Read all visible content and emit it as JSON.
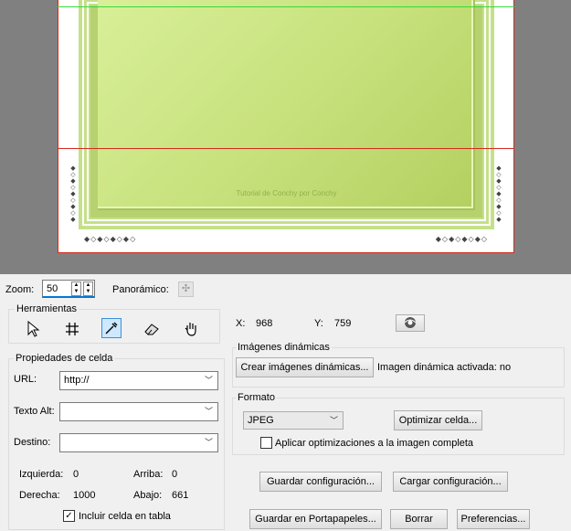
{
  "preview": {
    "watermark": "Tutorial de Conchy por Conchy"
  },
  "zoom": {
    "label": "Zoom:",
    "value": "50"
  },
  "pan": {
    "label": "Panorámico:"
  },
  "tools": {
    "title": "Herramientas",
    "items": [
      "arrow-select-icon",
      "grid-slice-icon",
      "eyedropper-icon",
      "eraser-icon",
      "hand-pan-icon"
    ]
  },
  "coords": {
    "x_label": "X:",
    "x_value": "968",
    "y_label": "Y:",
    "y_value": "759"
  },
  "cell_props": {
    "title": "Propiedades de celda",
    "url_label": "URL:",
    "url_value": "http://",
    "alt_label": "Texto Alt:",
    "alt_value": "",
    "target_label": "Destino:",
    "target_value": "",
    "left_label": "Izquierda:",
    "left_value": "0",
    "top_label": "Arriba:",
    "top_value": "0",
    "right_label": "Derecha:",
    "right_value": "1000",
    "bottom_label": "Abajo:",
    "bottom_value": "661",
    "include_label": "Incluir celda en tabla",
    "include_checked": true
  },
  "dynamic": {
    "title": "Imágenes dinámicas",
    "create_button": "Crear imágenes dinámicas...",
    "status": "Imagen dinámica activada: no"
  },
  "format": {
    "title": "Formato",
    "selected": "JPEG",
    "optimize_button": "Optimizar celda...",
    "apply_all_label": "Aplicar optimizaciones a la imagen completa",
    "apply_all_checked": false
  },
  "buttons": {
    "save_settings": "Guardar configuración...",
    "load_settings": "Cargar configuración...",
    "save_clipboard": "Guardar en Portapapeles...",
    "clear": "Borrar",
    "preferences": "Preferencias..."
  }
}
